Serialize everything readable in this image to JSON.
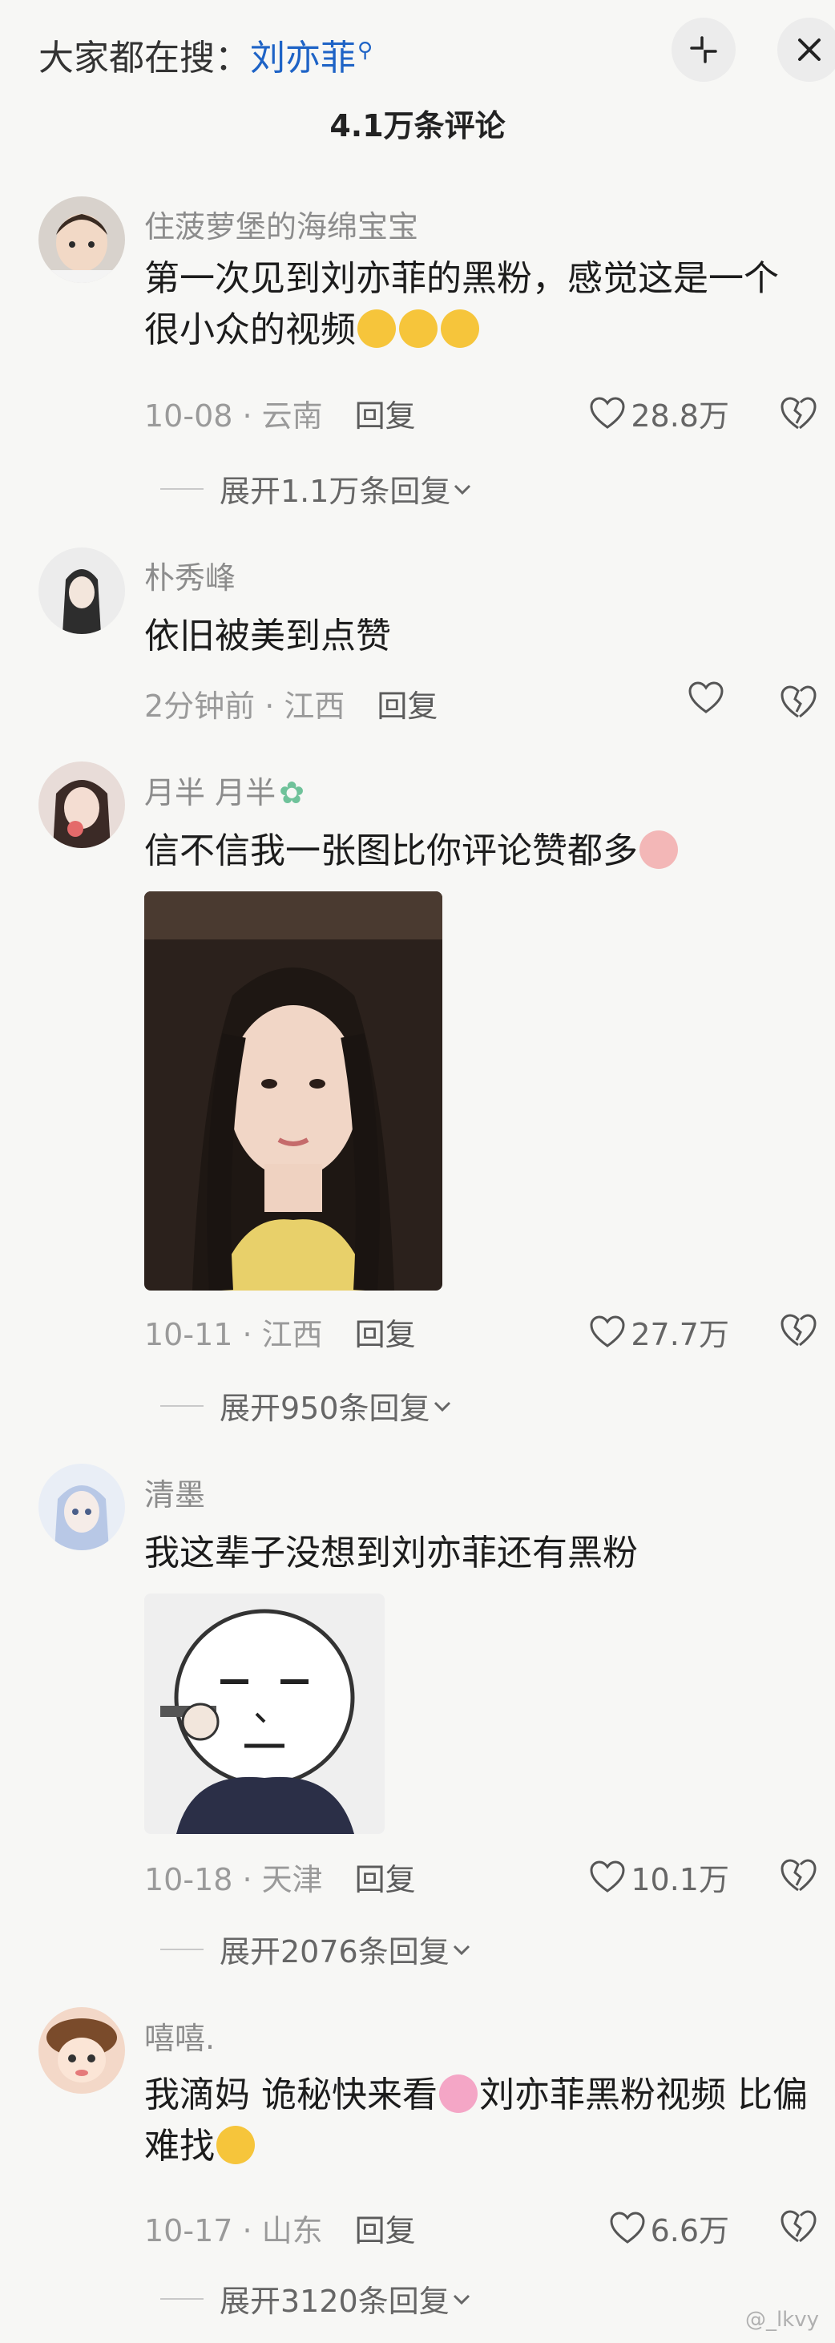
{
  "header": {
    "search_prefix": "大家都在搜：",
    "search_keyword": "刘亦菲",
    "comment_count": "4.1万条评论"
  },
  "comments": [
    {
      "username": "住菠萝堡的海绵宝宝",
      "text": "第一次见到刘亦菲的黑粉，感觉这是一个很小众的视频",
      "date_location": "10-08 · 云南",
      "reply_label": "回复",
      "likes": "28.8万",
      "expand": "展开1.1万条回复"
    },
    {
      "username": "朴秀峰",
      "text": "依旧被美到点赞",
      "date_location": "2分钟前 · 江西",
      "reply_label": "回复",
      "likes": "",
      "expand": ""
    },
    {
      "username": "月半   月半",
      "text": "信不信我一张图比你评论赞都多",
      "date_location": "10-11 · 江西",
      "reply_label": "回复",
      "likes": "27.7万",
      "expand": "展开950条回复"
    },
    {
      "username": "清墨",
      "text": "我这辈子没想到刘亦菲还有黑粉",
      "date_location": "10-18 · 天津",
      "reply_label": "回复",
      "likes": "10.1万",
      "expand": "展开2076条回复"
    },
    {
      "username": "嘻嘻.",
      "text_part1": "我滴妈  诡秘快来看",
      "text_part2": "刘亦菲黑粉视频  比偏难找",
      "date_location": "10-17 · 山东",
      "reply_label": "回复",
      "likes": "6.6万",
      "expand": "展开3120条回复"
    }
  ],
  "watermark": "@_lkvy",
  "colors": {
    "keyword": "#1e63c6",
    "background": "#f7f7f5",
    "muted": "#9a9a9a"
  }
}
